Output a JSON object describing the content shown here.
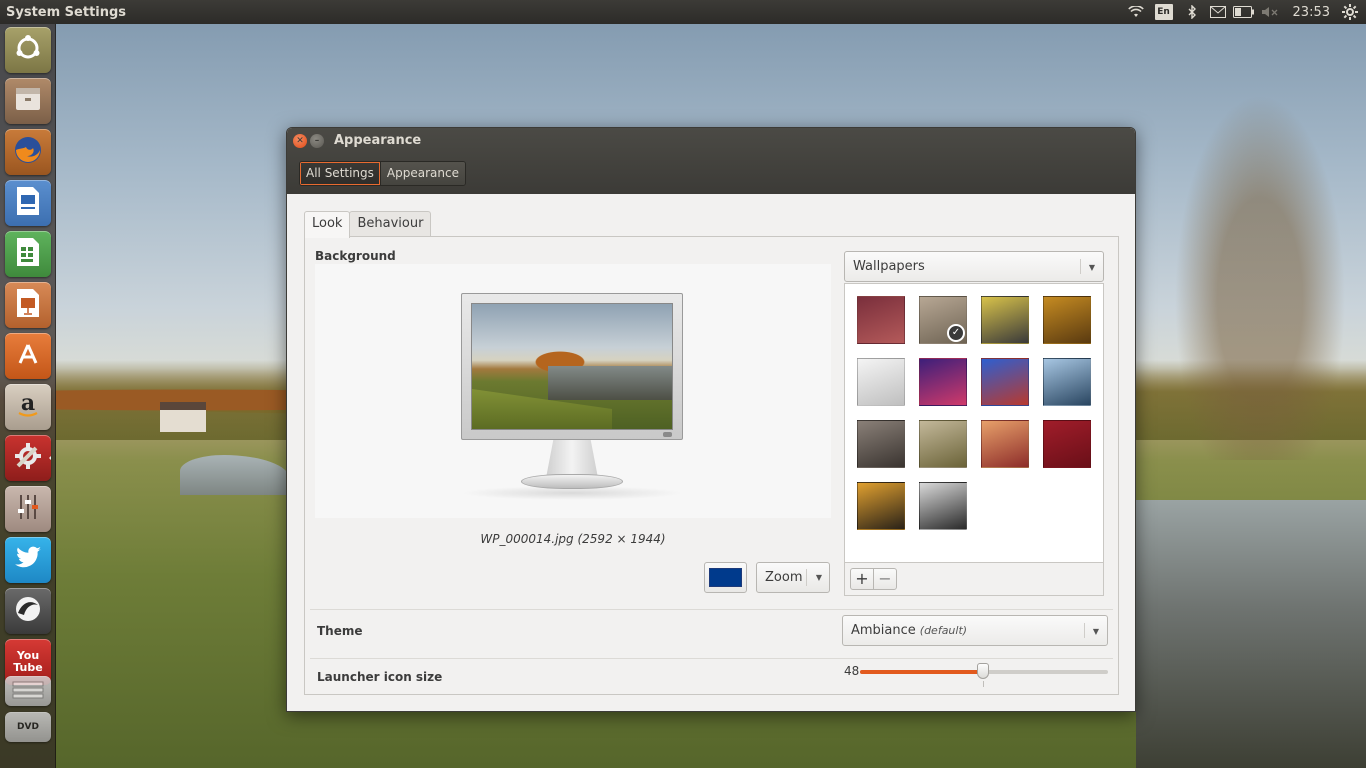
{
  "top_panel": {
    "app_title": "System Settings",
    "keyboard_layout": "En",
    "clock": "23:53",
    "indicators": [
      "wifi-icon",
      "bluetooth-icon",
      "mail-icon",
      "battery-icon",
      "volume-muted-icon",
      "gear-icon"
    ]
  },
  "launcher": {
    "items": [
      {
        "name": "dash-home",
        "icon": "ubuntu-logo-icon"
      },
      {
        "name": "files",
        "icon": "file-cabinet-icon"
      },
      {
        "name": "firefox",
        "icon": "firefox-icon"
      },
      {
        "name": "libreoffice-writer",
        "icon": "writer-icon"
      },
      {
        "name": "libreoffice-calc",
        "icon": "calc-icon"
      },
      {
        "name": "libreoffice-impress",
        "icon": "impress-icon"
      },
      {
        "name": "software-center",
        "icon": "shopping-bag-icon"
      },
      {
        "name": "amazon",
        "icon": "amazon-icon"
      },
      {
        "name": "system-settings",
        "icon": "settings-icon",
        "active": true
      },
      {
        "name": "sound-mixer",
        "icon": "mixer-icon"
      },
      {
        "name": "twitter",
        "icon": "twitter-bird-icon"
      },
      {
        "name": "grooveshark",
        "icon": "grooveshark-icon"
      },
      {
        "name": "youtube",
        "icon": "youtube-icon",
        "label": "You Tube"
      },
      {
        "name": "workspace-disk",
        "icon": "disk-icon"
      },
      {
        "name": "dvd",
        "icon": "dvd-icon",
        "label": "DVD"
      }
    ]
  },
  "window": {
    "title": "Appearance",
    "breadcrumb": [
      "All Settings",
      "Appearance"
    ],
    "tabs": [
      {
        "label": "Look",
        "active": true
      },
      {
        "label": "Behaviour",
        "active": false
      }
    ],
    "background": {
      "label": "Background",
      "file_caption": "WP_000014.jpg (2592 × 1944)",
      "color": "#003a8c",
      "mode": "Zoom",
      "source": "Wallpapers"
    },
    "wallpapers": [
      {
        "name": "wallpaper-warty-final",
        "colors": [
          "#7a2f3c",
          "#b45a5a"
        ]
      },
      {
        "name": "wallpaper-valley",
        "colors": [
          "#b7a794",
          "#6f6454"
        ],
        "selected": true
      },
      {
        "name": "wallpaper-sound-desk",
        "colors": [
          "#d8c24a",
          "#3a3a3a"
        ]
      },
      {
        "name": "wallpaper-leaf",
        "colors": [
          "#c58b22",
          "#5a3a10"
        ]
      },
      {
        "name": "wallpaper-snow",
        "colors": [
          "#f4f4f4",
          "#bfbfbf"
        ]
      },
      {
        "name": "wallpaper-disco-floor",
        "colors": [
          "#3d1f7a",
          "#d03a6a"
        ]
      },
      {
        "name": "wallpaper-turntable",
        "colors": [
          "#2e5fd0",
          "#b9392e"
        ]
      },
      {
        "name": "wallpaper-sea-sky",
        "colors": [
          "#a7c6e2",
          "#2a4661"
        ]
      },
      {
        "name": "wallpaper-stones",
        "colors": [
          "#8a8078",
          "#3a3430"
        ]
      },
      {
        "name": "wallpaper-mountain-valley",
        "colors": [
          "#c3b89a",
          "#6b6338"
        ]
      },
      {
        "name": "wallpaper-bokeh",
        "colors": [
          "#e7a06a",
          "#8d2d2a"
        ]
      },
      {
        "name": "wallpaper-red-swirl",
        "colors": [
          "#a01d2a",
          "#6a0f18"
        ]
      },
      {
        "name": "wallpaper-sunset-grass",
        "colors": [
          "#e0a030",
          "#2a2218"
        ]
      },
      {
        "name": "wallpaper-skyscraper",
        "colors": [
          "#d9d9d9",
          "#2a2a2a"
        ]
      }
    ],
    "theme": {
      "label": "Theme",
      "value": "Ambiance",
      "hint": "(default)"
    },
    "launcher_icon_size": {
      "label": "Launcher icon size",
      "value": "48",
      "min": 32,
      "max": 64
    },
    "accent_color": "#e25a1e"
  }
}
